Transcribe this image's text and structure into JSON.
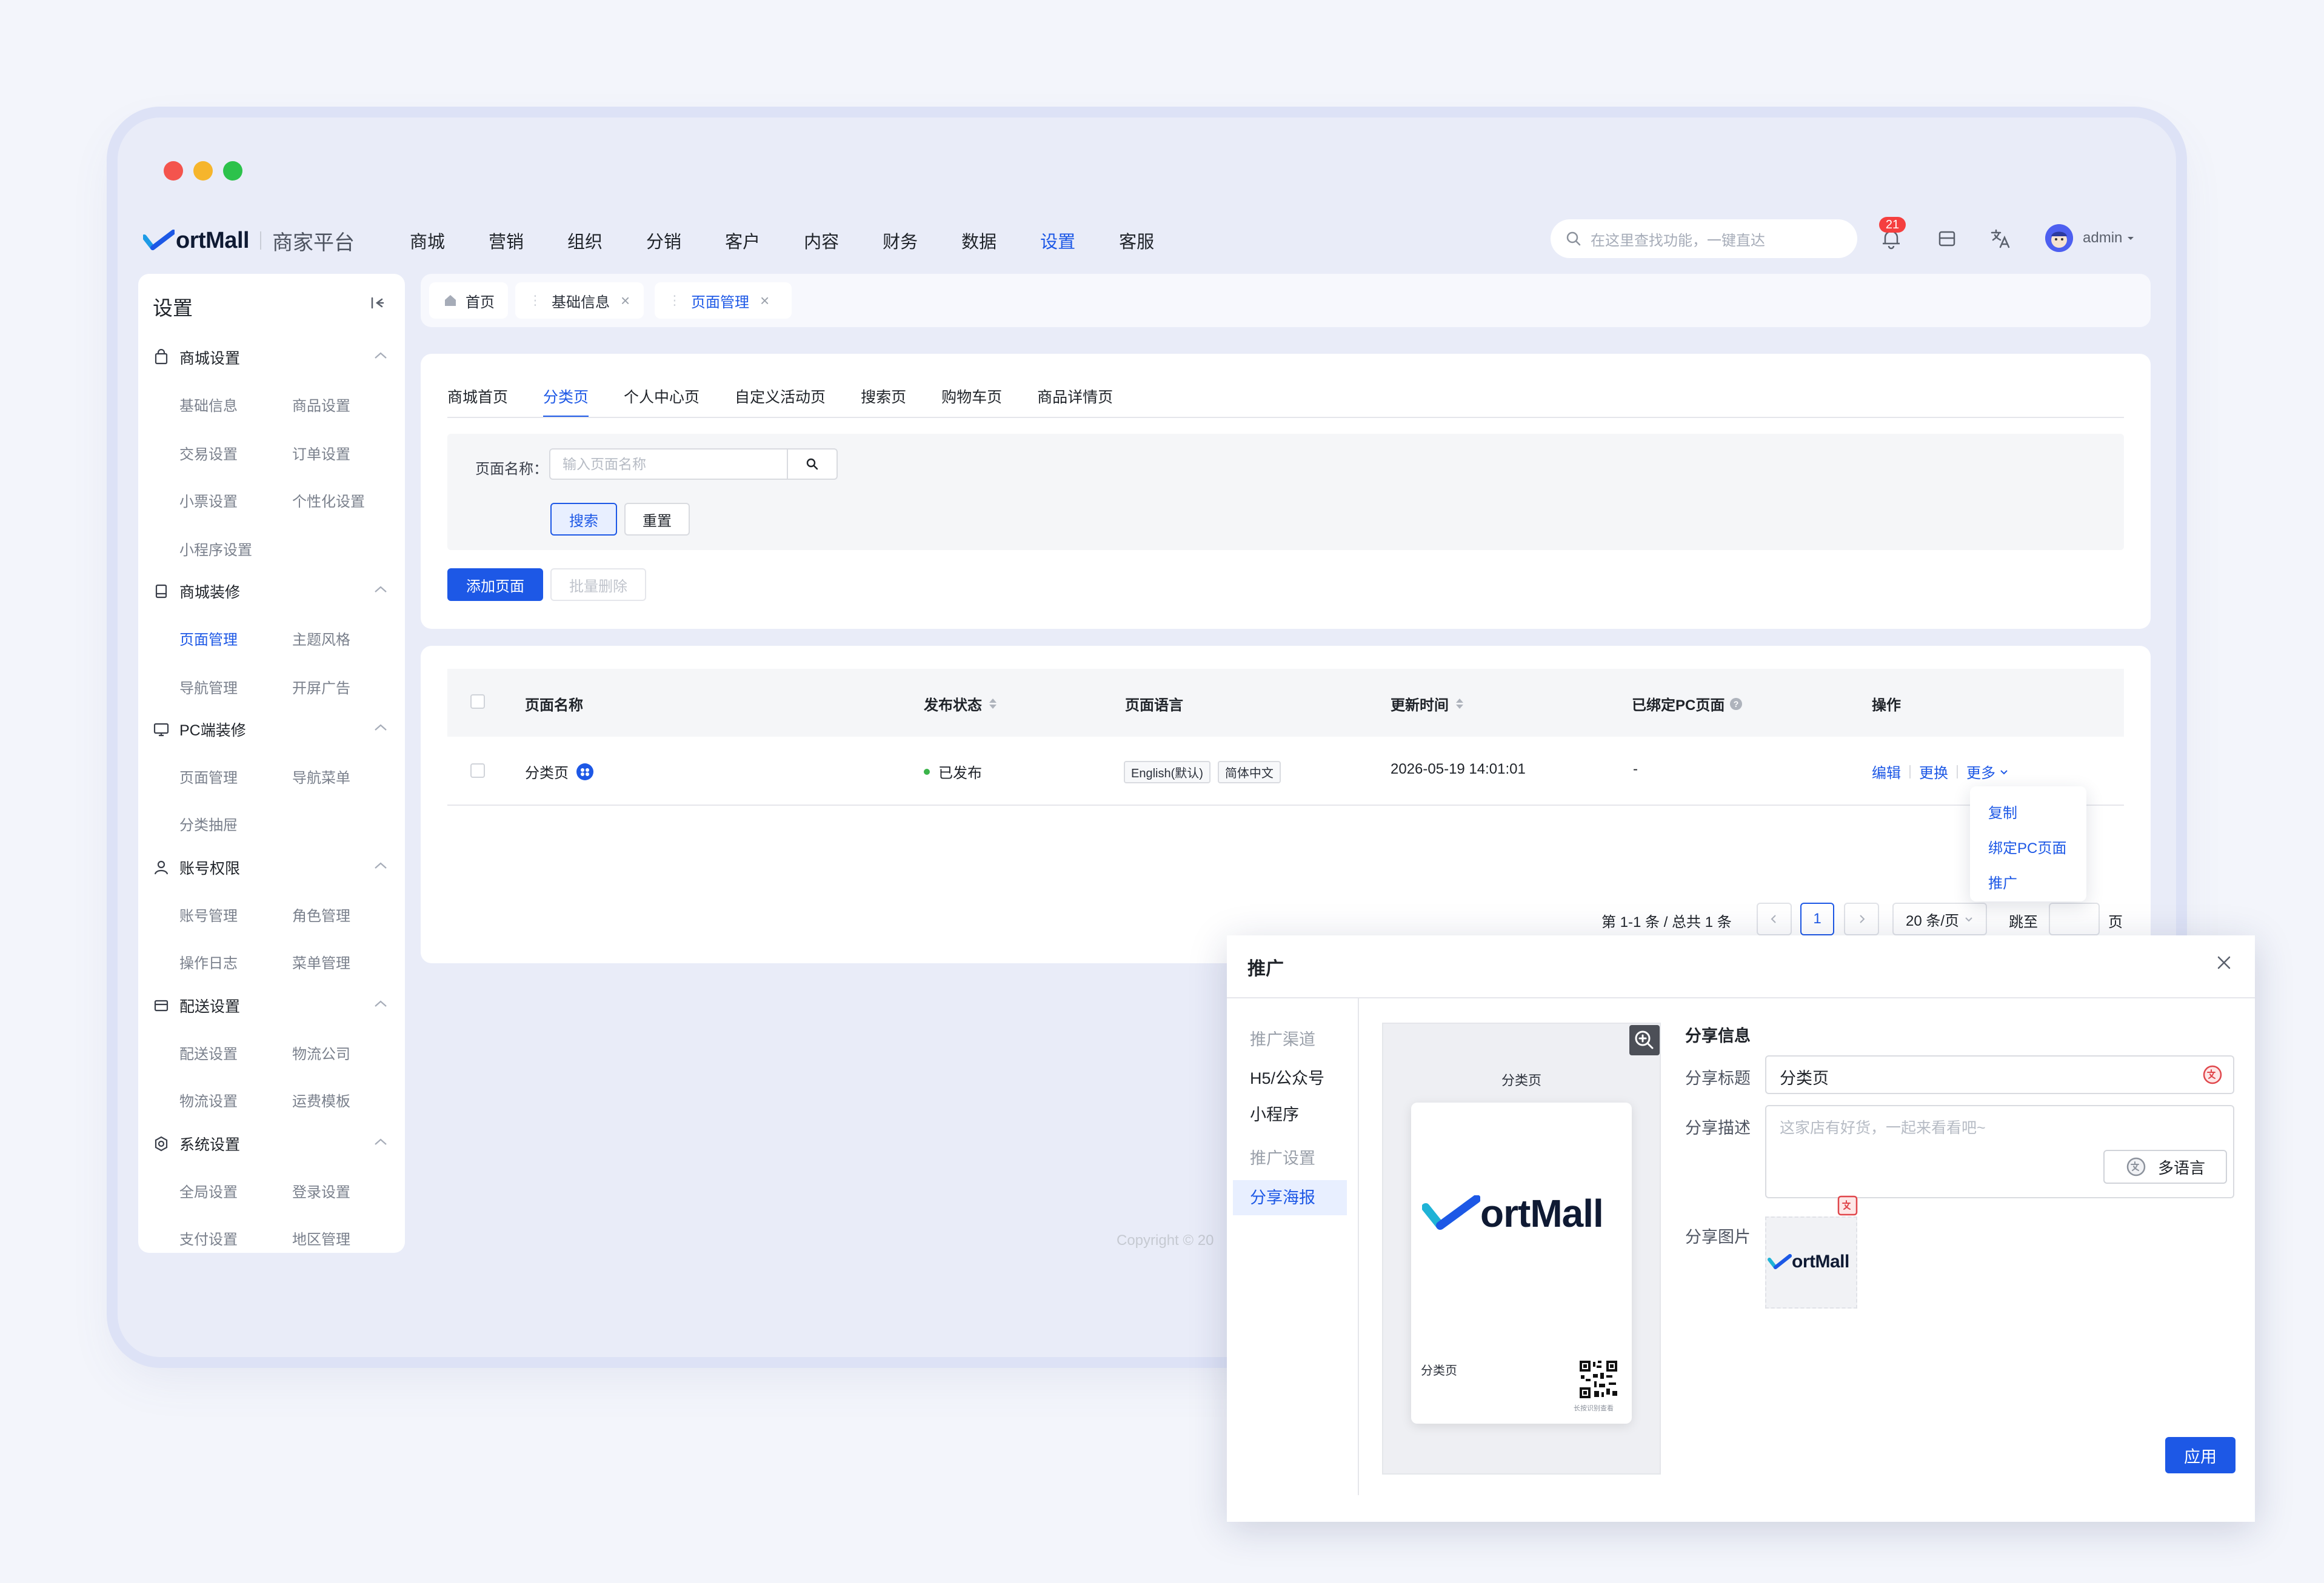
{
  "brand": {
    "name": "ortMall",
    "platform": "商家平台",
    "accent": "#1d58e6"
  },
  "topnav": {
    "items": [
      "商城",
      "营销",
      "组织",
      "分销",
      "客户",
      "内容",
      "财务",
      "数据",
      "设置",
      "客服"
    ],
    "active": "设置",
    "search_placeholder": "在这里查找功能，一键直达",
    "notification_count": "21",
    "user": "admin"
  },
  "sidebar": {
    "title": "设置",
    "groups": [
      {
        "label": "商城设置",
        "icon": "shop-settings-icon",
        "items": [
          "基础信息",
          "商品设置",
          "交易设置",
          "订单设置",
          "小票设置",
          "个性化设置",
          "小程序设置"
        ]
      },
      {
        "label": "商城装修",
        "icon": "decoration-icon",
        "items": [
          "页面管理",
          "主题风格",
          "导航管理",
          "开屏广告"
        ]
      },
      {
        "label": "PC端装修",
        "icon": "monitor-icon",
        "items": [
          "页面管理",
          "导航菜单",
          "分类抽屉"
        ]
      },
      {
        "label": "账号权限",
        "icon": "user-permission-icon",
        "items": [
          "账号管理",
          "角色管理",
          "操作日志",
          "菜单管理"
        ]
      },
      {
        "label": "配送设置",
        "icon": "delivery-icon",
        "items": [
          "配送设置",
          "物流公司",
          "物流设置",
          "运费模板"
        ]
      },
      {
        "label": "系统设置",
        "icon": "system-settings-icon",
        "items": [
          "全局设置",
          "登录设置",
          "支付设置",
          "地区管理"
        ]
      }
    ]
  },
  "tabs": [
    {
      "label": "首页",
      "active": false
    },
    {
      "label": "基础信息",
      "active": false
    },
    {
      "label": "页面管理",
      "active": true
    }
  ],
  "page_tabs": [
    "商城首页",
    "分类页",
    "个人中心页",
    "自定义活动页",
    "搜索页",
    "购物车页",
    "商品详情页"
  ],
  "page_tabs_active": "分类页",
  "filter": {
    "label": "页面名称：",
    "placeholder": "输入页面名称",
    "search_button": "搜索",
    "reset_button": "重置"
  },
  "actions": {
    "add": "添加页面",
    "batch_delete": "批量删除"
  },
  "table": {
    "columns": [
      "页面名称",
      "发布状态",
      "页面语言",
      "更新时间",
      "已绑定PC页面",
      "操作"
    ],
    "rows": [
      {
        "name": "分类页",
        "status": "已发布",
        "languages": [
          "English(默认)",
          "简体中文"
        ],
        "updated": "2026-05-19 14:01:01",
        "pc_page": "-",
        "ops": [
          "编辑",
          "更换",
          "更多"
        ]
      }
    ]
  },
  "more_menu": [
    "复制",
    "绑定PC页面",
    "推广"
  ],
  "pagination": {
    "summary": "第 1-1 条 / 总共 1 条",
    "current": "1",
    "page_size": "20 条/页",
    "jump_label": "跳至",
    "page_unit": "页"
  },
  "copyright": "Copyright © 20",
  "modal": {
    "title": "推广",
    "menu": [
      {
        "label": "推广渠道",
        "type": "group"
      },
      {
        "label": "H5/公众号",
        "type": "item"
      },
      {
        "label": "小程序",
        "type": "item"
      },
      {
        "label": "推广设置",
        "type": "group"
      },
      {
        "label": "分享海报",
        "type": "active"
      }
    ],
    "poster": {
      "title": "分类页",
      "brand": "ortMall",
      "page_name": "分类页",
      "qr_caption": "长按识别查看"
    },
    "share": {
      "heading": "分享信息",
      "title_label": "分享标题",
      "title_value": "分类页",
      "desc_label": "分享描述",
      "desc_placeholder": "这家店有好货，一起来看看吧~",
      "multi_lang": "多语言",
      "image_label": "分享图片",
      "image_brand": "ortMall"
    },
    "apply": "应用"
  }
}
